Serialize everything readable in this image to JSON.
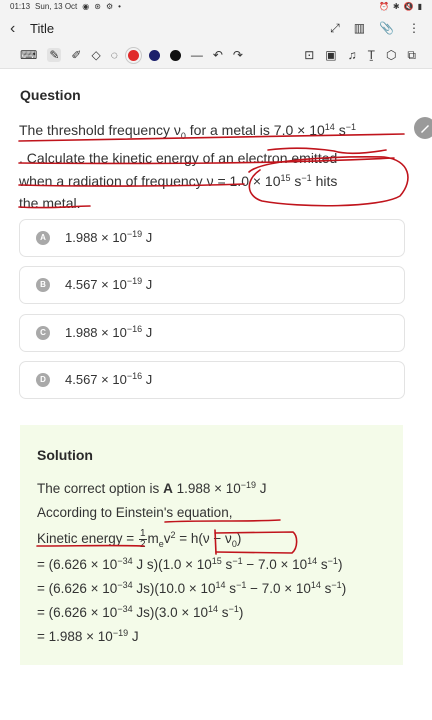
{
  "status": {
    "time": "01:13",
    "date": "Sun, 13 Oct",
    "dot": "•"
  },
  "header": {
    "title": "Title"
  },
  "question": {
    "heading": "Question",
    "l1a": "The threshold frequency ν",
    "l1sub": "0",
    "l1b": " for a metal is 7.0 × 10",
    "l1sup": "14",
    "l1c": " s",
    "l1sup2": "−1",
    "l2": ". Calculate the kinetic energy of an electron emitted",
    "l3a": "when a radiation of frequency ν = 1.0 × 10",
    "l3sup": "15",
    "l3b": " s",
    "l3sup2": "−1",
    "l3c": " hits",
    "l4": "the metal."
  },
  "options": [
    {
      "letter": "A",
      "mant": "1.988 × 10",
      "exp": "−19",
      "unit": " J"
    },
    {
      "letter": "B",
      "mant": "4.567 × 10",
      "exp": "−19",
      "unit": " J"
    },
    {
      "letter": "C",
      "mant": "1.988 × 10",
      "exp": "−16",
      "unit": " J"
    },
    {
      "letter": "D",
      "mant": "4.567 × 10",
      "exp": "−16",
      "unit": " J"
    }
  ],
  "solution": {
    "heading": "Solution",
    "s1a": "The correct option is ",
    "s1b": "A",
    "s1c": " 1.988 × 10",
    "s1sup": "−19",
    "s1d": " J",
    "s2": "According to Einstein's equation,",
    "s3a": "Kinetic energy = ",
    "s3n": "1",
    "s3d": "2",
    "s3b": "m",
    "s3bsub": "e",
    "s3c": "v",
    "s3csup": "2",
    "s3e": " = h(ν − ν",
    "s3esub": "0",
    "s3f": ")",
    "s4a": "= (6.626 × 10",
    "s4s1": "−34",
    "s4b": " J s)(1.0 × 10",
    "s4s2": "15",
    "s4c": " s",
    "s4s3": "−1",
    "s4d": " − 7.0 × 10",
    "s4s4": "14",
    "s4e": " s",
    "s4s5": "−1",
    "s4f": ")",
    "s5a": "= (6.626 × 10",
    "s5s1": "−34",
    "s5b": " Js)(10.0 × 10",
    "s5s2": "14",
    "s5c": " s",
    "s5s3": "−1",
    "s5d": " − 7.0 × 10",
    "s5s4": "14",
    "s5e": " s",
    "s5s5": "−1",
    "s5f": ")",
    "s6a": "= (6.626 × 10",
    "s6s1": "−34",
    "s6b": " Js)(3.0 × 10",
    "s6s2": "14",
    "s6c": " s",
    "s6s3": "−1",
    "s6d": ")",
    "s7a": "= 1.988 × 10",
    "s7s1": "−19",
    "s7b": " J"
  },
  "colors": {
    "ink": "#c0141c",
    "accent_red": "#e02a2a",
    "navy": "#1b1f6b",
    "solution_bg": "#f4fbe9"
  }
}
